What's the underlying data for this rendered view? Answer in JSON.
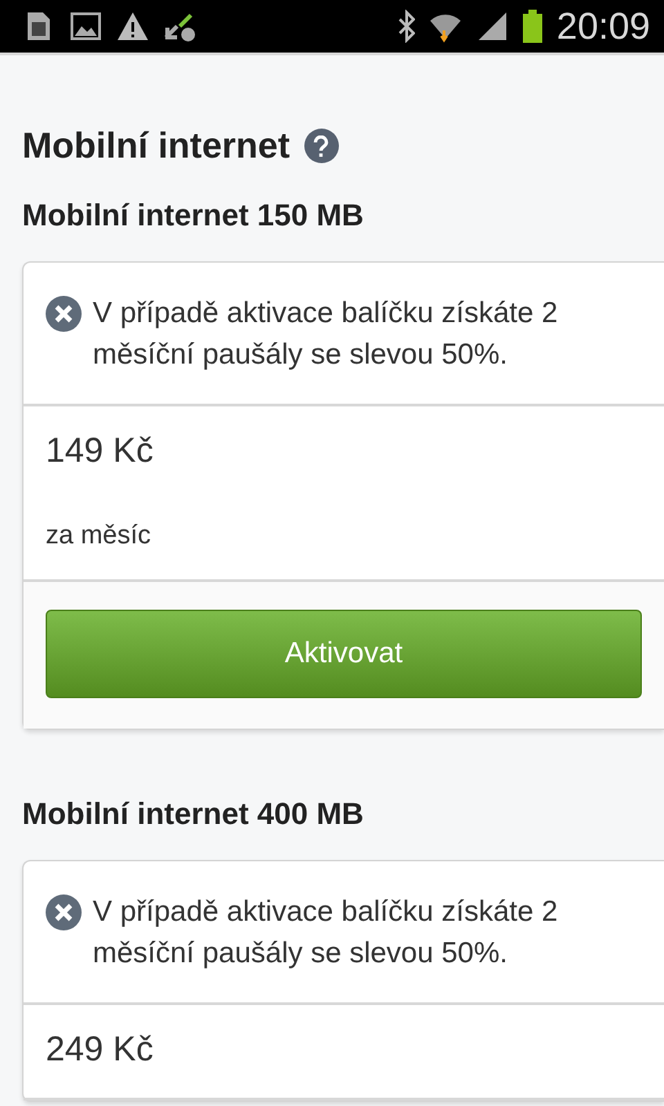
{
  "status_bar": {
    "time": "20:09"
  },
  "heading": "Mobilní internet",
  "packages": [
    {
      "title": "Mobilní internet 150 MB",
      "notice": "V případě aktivace balíčku získáte 2 měsíční paušály se slevou 50%.",
      "price": "149 Kč",
      "period": "za měsíc",
      "button": "Aktivovat"
    },
    {
      "title": "Mobilní internet 400 MB",
      "notice": "V případě aktivace balíčku získáte 2 měsíční paušály se slevou 50%.",
      "price": "249 Kč"
    }
  ]
}
